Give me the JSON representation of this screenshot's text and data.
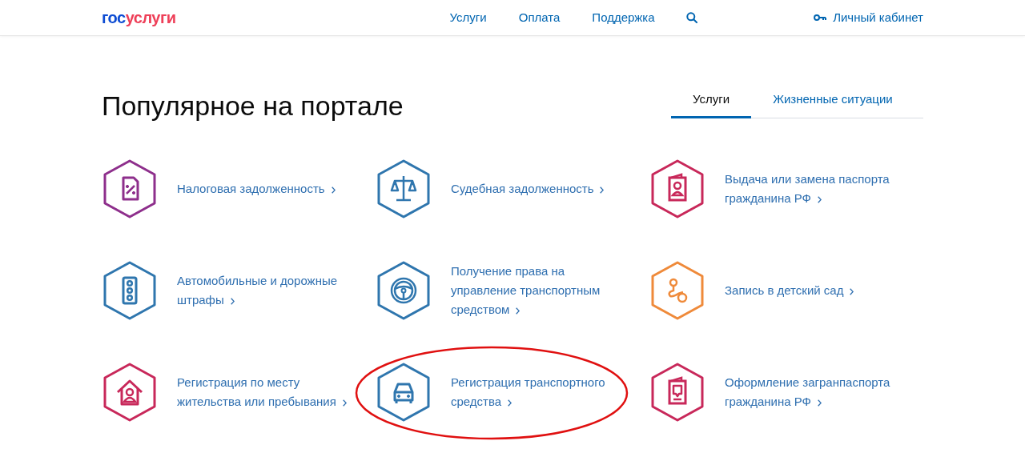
{
  "header": {
    "logo": {
      "prefix": "гос",
      "suffix": "услуги"
    },
    "nav": [
      "Услуги",
      "Оплата",
      "Поддержка"
    ],
    "account": "Личный кабинет"
  },
  "title": "Популярное на портале",
  "tabs": [
    {
      "label": "Услуги",
      "selected": true
    },
    {
      "label": "Жизненные ситуации",
      "selected": false
    }
  ],
  "services": [
    {
      "kind": "tax",
      "color": "#8e2f8c",
      "text": "Налоговая задолженность",
      "highlighted": false
    },
    {
      "kind": "court",
      "color": "#2f76ae",
      "text": "Судебная задолженность",
      "highlighted": false
    },
    {
      "kind": "passport",
      "color": "#c8285a",
      "text": "Выдача или замена паспорта\nгражданина РФ",
      "highlighted": false
    },
    {
      "kind": "traffic",
      "color": "#2f76ae",
      "text": "Автомобильные и дорожные\nштрафы",
      "highlighted": false
    },
    {
      "kind": "wheel",
      "color": "#2f76ae",
      "text": "Получение права на\nуправление транспортным\nсредством",
      "highlighted": false
    },
    {
      "kind": "kindergarten",
      "color": "#ef8a3a",
      "text": "Запись в детский сад",
      "highlighted": false
    },
    {
      "kind": "residence",
      "color": "#c8285a",
      "text": "Регистрация по месту\nжительства или пребывания",
      "highlighted": false
    },
    {
      "kind": "car",
      "color": "#2f76ae",
      "text": "Регистрация транспортного\nсредства",
      "highlighted": true
    },
    {
      "kind": "foreign-passport",
      "color": "#c8285a",
      "text": "Оформление загранпаспорта\nгражданина РФ",
      "highlighted": false
    }
  ]
}
